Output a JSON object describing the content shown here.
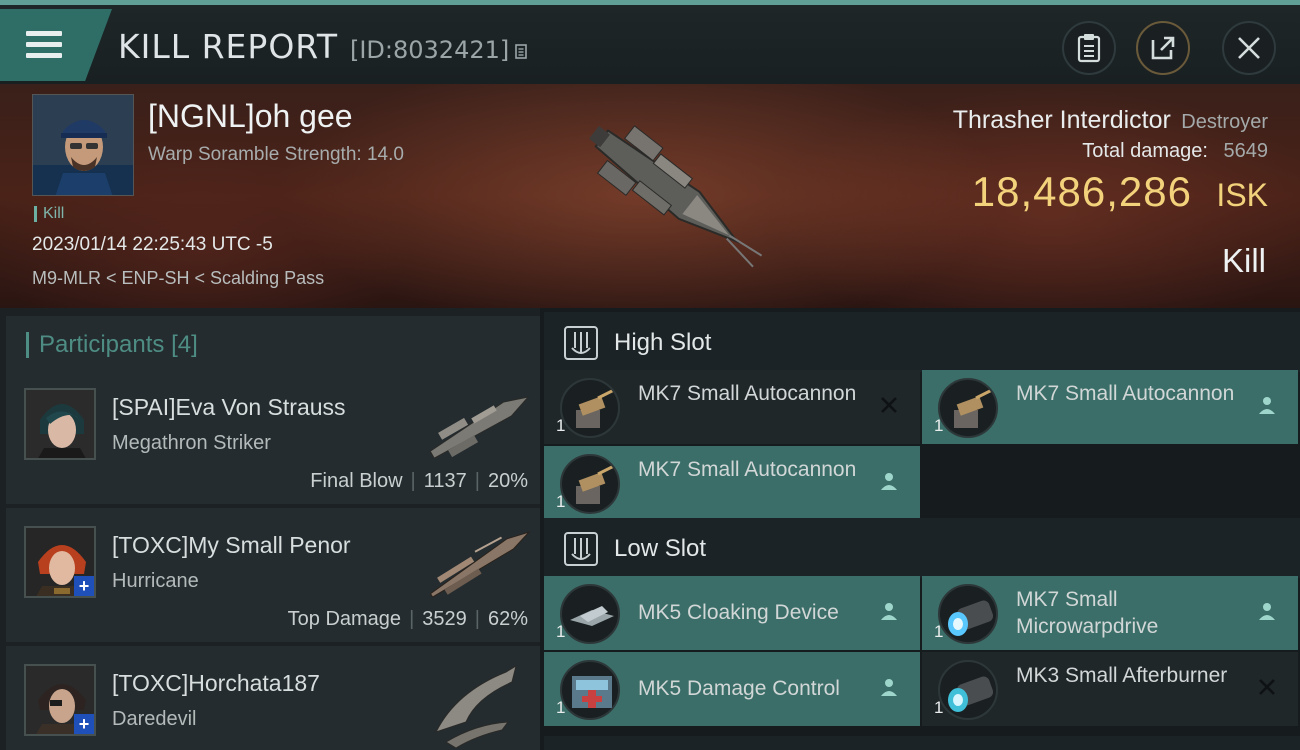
{
  "header": {
    "title": "KILL REPORT",
    "kill_id": "[ID:8032421]"
  },
  "victim": {
    "name": "[NGNL]oh gee",
    "warp_scramble": "Warp Soramble Strength: 14.0",
    "tag": "Kill",
    "datetime": "2023/01/14 22:25:43 UTC -5",
    "location": "M9-MLR < ENP-SH < Scalding Pass",
    "ship_name": "Thrasher Interdictor",
    "ship_class": "Destroyer",
    "total_damage_label": "Total damage:",
    "total_damage": "5649",
    "isk_value": "18,486,286",
    "isk_unit": "ISK",
    "result": "Kill"
  },
  "participants": {
    "title": "Participants",
    "count": "[4]",
    "rows": [
      {
        "name": "[SPAI]Eva Von Strauss",
        "ship": "Megathron Striker",
        "role": "Final Blow",
        "damage": "1137",
        "percent": "20%"
      },
      {
        "name": "[TOXC]My Small Penor",
        "ship": "Hurricane",
        "role": "Top Damage",
        "damage": "3529",
        "percent": "62%"
      },
      {
        "name": "[TOXC]Horchata187",
        "ship": "Daredevil"
      }
    ]
  },
  "slots": {
    "high": {
      "label": "High Slot",
      "items": [
        {
          "name": "MK7 Small Autocannon",
          "qty": "1",
          "status": "destroyed"
        },
        {
          "name": "MK7 Small Autocannon",
          "qty": "1",
          "status": "dropped"
        },
        {
          "name": "MK7 Small Autocannon",
          "qty": "1",
          "status": "dropped"
        }
      ]
    },
    "low": {
      "label": "Low Slot",
      "items": [
        {
          "name": "MK5 Cloaking Device",
          "qty": "1",
          "status": "dropped"
        },
        {
          "name": "MK7 Small Microwarpdrive",
          "qty": "1",
          "status": "dropped"
        },
        {
          "name": "MK5 Damage Control",
          "qty": "1",
          "status": "dropped"
        },
        {
          "name": "MK3 Small Afterburner",
          "qty": "1",
          "status": "destroyed"
        }
      ]
    }
  },
  "colors": {
    "accent": "#3b6e68",
    "isk": "#f3d27c",
    "participants_title": "#4e8d84"
  }
}
